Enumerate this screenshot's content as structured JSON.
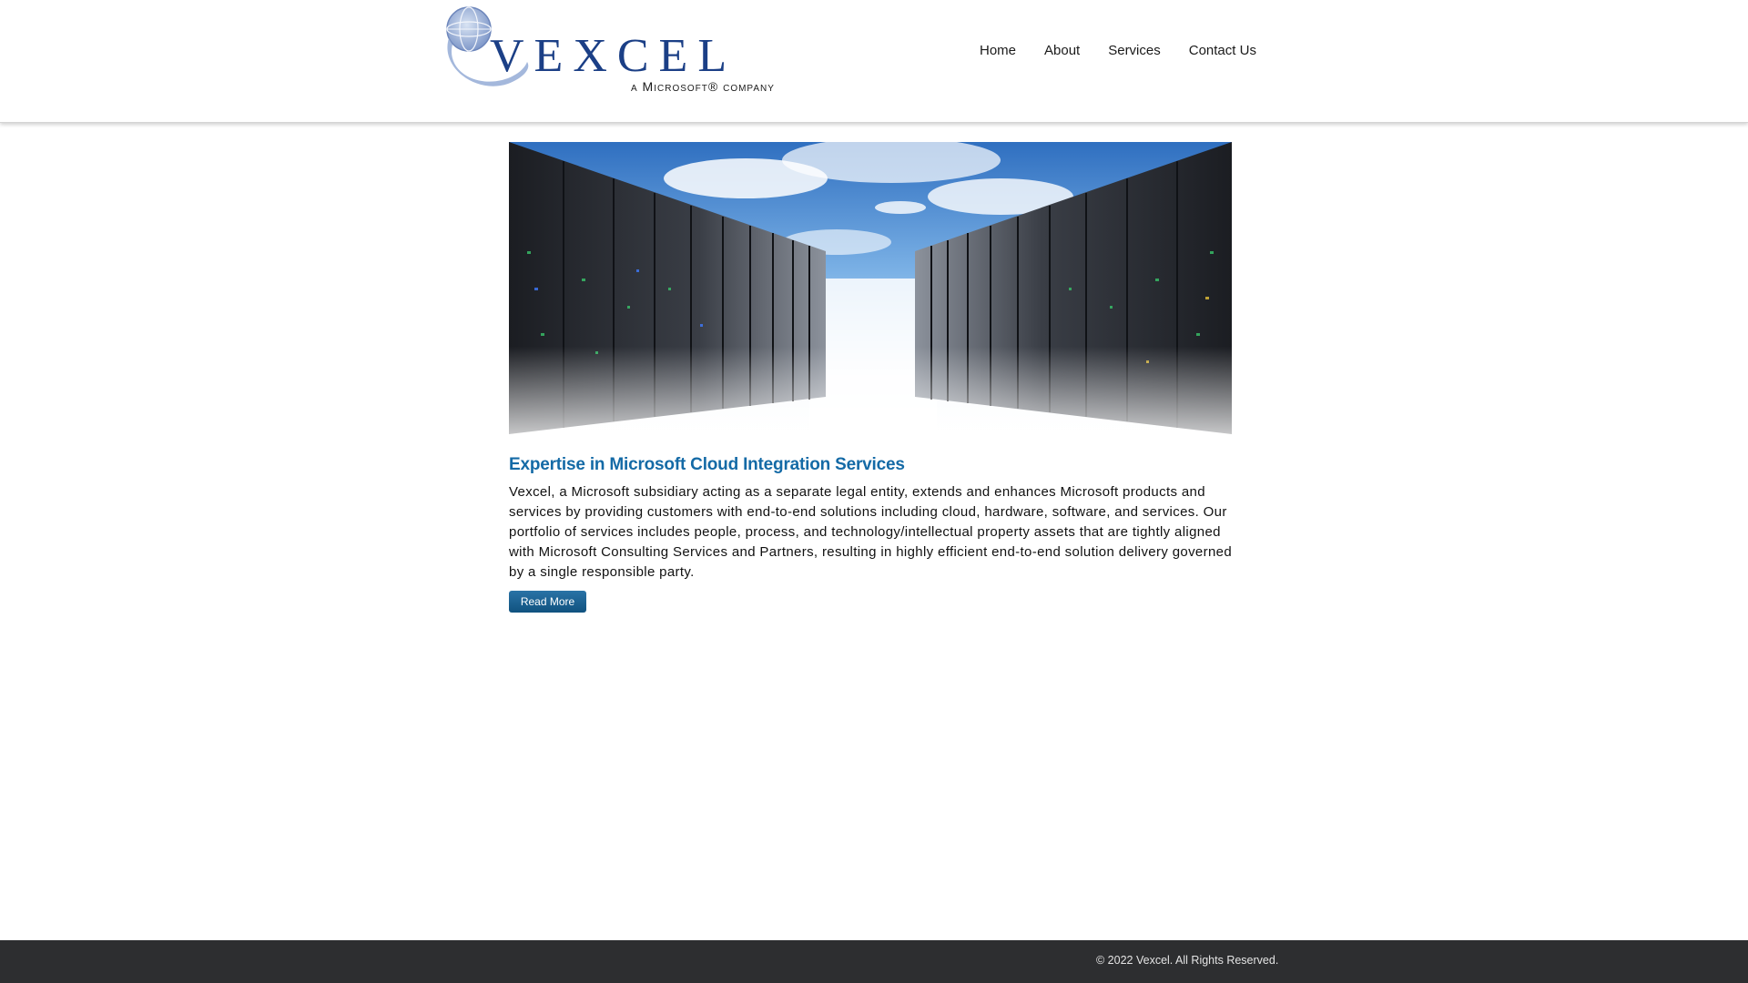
{
  "logo": {
    "wordmark": "VEXCEL",
    "tagline": "a Microsoft® company",
    "icon": "globe-swoosh-icon",
    "color": "#1b3f86"
  },
  "nav": {
    "items": [
      {
        "label": "Home"
      },
      {
        "label": "About"
      },
      {
        "label": "Services"
      },
      {
        "label": "Contact Us"
      }
    ]
  },
  "hero": {
    "description": "server racks receding toward a blue cloudy sky"
  },
  "main": {
    "title": "Expertise in Microsoft Cloud Integration Services",
    "paragraph": "Vexcel, a Microsoft subsidiary acting as a separate legal entity, extends and enhances Microsoft products and services by providing customers with end-to-end solutions including cloud, hardware, software, and services. Our portfolio of services includes people, process, and technology/intellectual property assets that are tightly aligned with Microsoft Consulting Services and Partners, resulting in highly efficient end-to-end solution delivery governed by a single responsible party.",
    "read_more": "Read More"
  },
  "footer": {
    "copyright": "© 2022 Vexcel. All Rights Reserved."
  },
  "colors": {
    "accent": "#146aa6",
    "button": "#1a5f8f",
    "footer": "#2d2e30"
  }
}
